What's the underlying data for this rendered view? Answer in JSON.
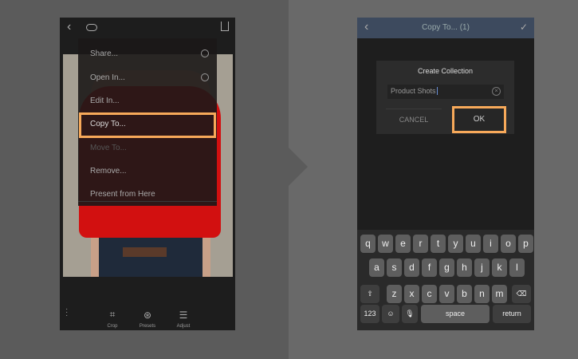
{
  "left_screen": {
    "menu_items": [
      "Share...",
      "Open In...",
      "Edit In...",
      "Copy To...",
      "Move To...",
      "Remove...",
      "Present from Here"
    ],
    "toolbar": [
      "Crop",
      "Presets",
      "Adjust"
    ]
  },
  "right_screen": {
    "header_title": "Copy To... (1)",
    "dialog_title": "Create Collection",
    "field_value": "Product Shots",
    "cancel": "CANCEL",
    "ok": "OK",
    "keyboard": {
      "row1": [
        "q",
        "w",
        "e",
        "r",
        "t",
        "y",
        "u",
        "i",
        "o",
        "p"
      ],
      "row2": [
        "a",
        "s",
        "d",
        "f",
        "g",
        "h",
        "j",
        "k",
        "l"
      ],
      "row3": [
        "z",
        "x",
        "c",
        "v",
        "b",
        "n",
        "m"
      ],
      "numbers": "123",
      "space": "space",
      "return": "return"
    }
  },
  "colors": {
    "highlight": "#f7a95a",
    "header": "#3d4a5e"
  }
}
